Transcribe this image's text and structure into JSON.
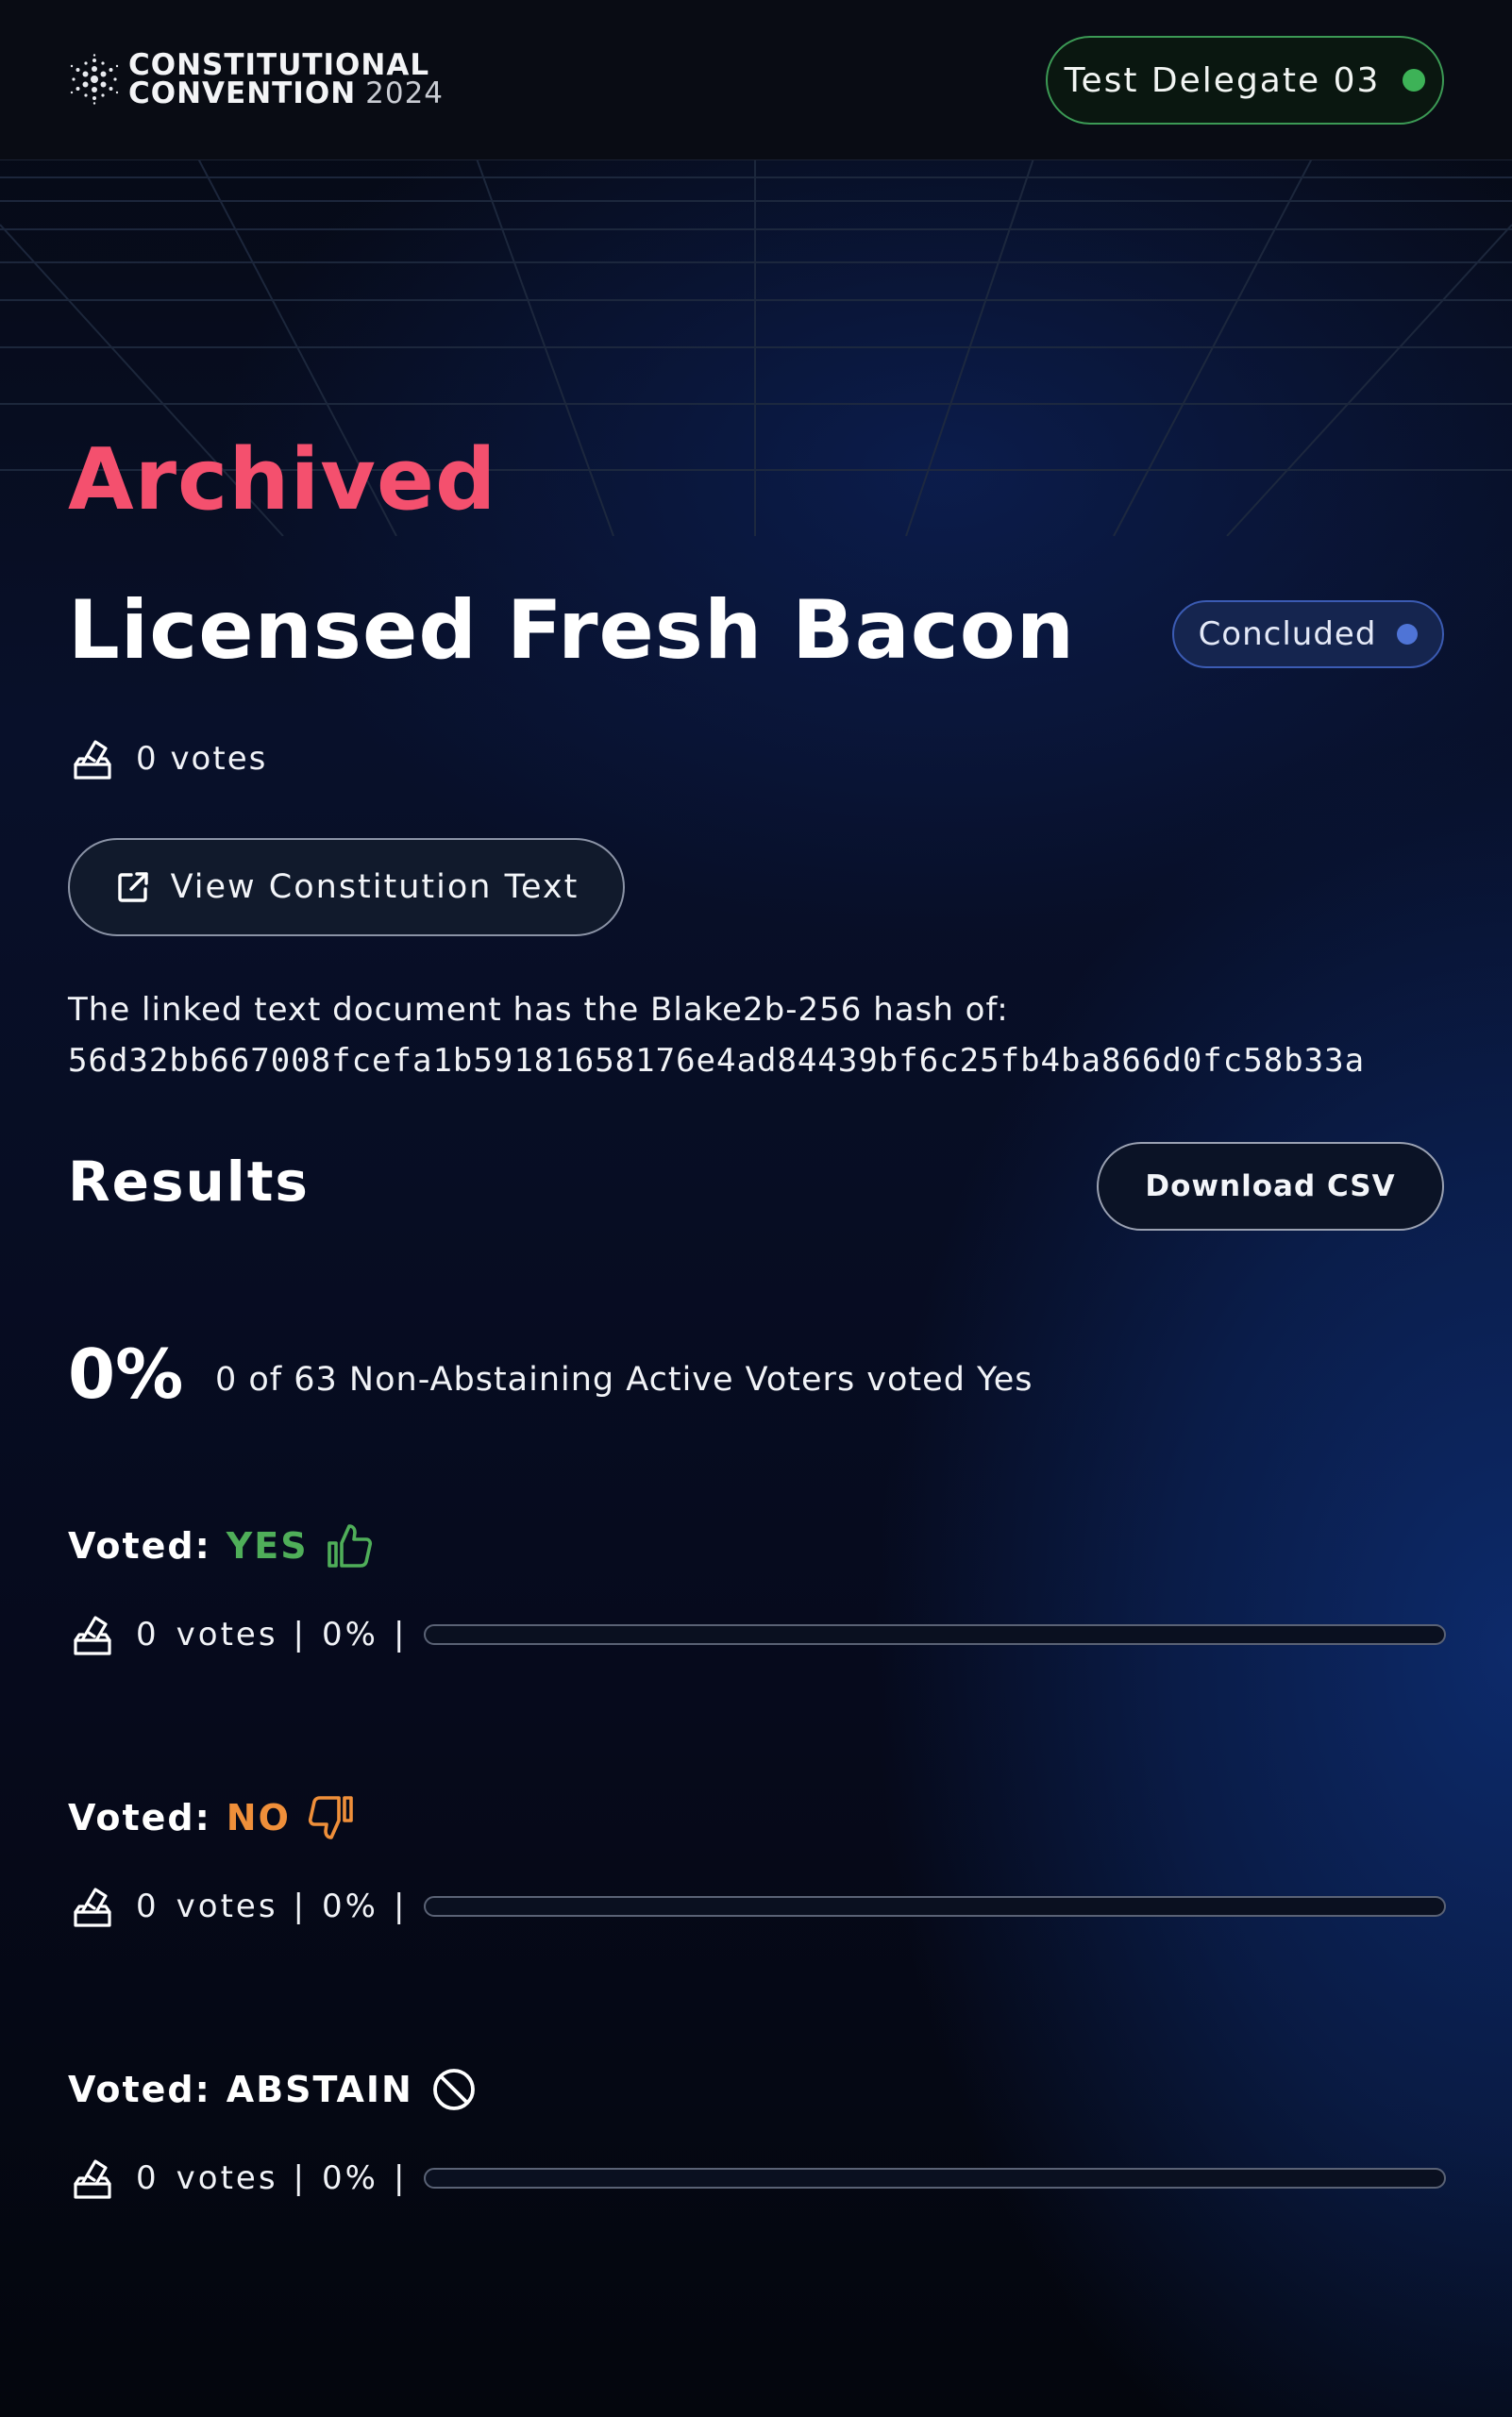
{
  "header": {
    "logo_line1": "CONSTITUTIONAL",
    "logo_line2": "CONVENTION",
    "logo_year": "2024",
    "logo_icon": "cardano-logo-icon",
    "delegate_name": "Test Delegate 03",
    "delegate_status_color": "#3db257"
  },
  "poll": {
    "archived_label": "Archived",
    "title": "Licensed Fresh Bacon",
    "status_label": "Concluded",
    "status_color": "#4f74d6",
    "vote_count_label": "0 votes",
    "view_button_label": "View Constitution Text",
    "hash_intro": "The linked text document has the Blake2b-256 hash of:",
    "hash_value": "56d32bb667008fcefa1b59181658176e4ad84439bf6c25fb4ba866d0fc58b33a"
  },
  "results": {
    "title": "Results",
    "download_label": "Download CSV",
    "percent": "0%",
    "summary": "0 of 63 Non-Abstaining Active Voters voted Yes",
    "options": [
      {
        "voted_label": "Voted:",
        "option": "YES",
        "icon": "thumbs-up-icon",
        "color": "#4fae59",
        "votes": "0",
        "votes_word": "votes",
        "percent": "0%",
        "fill": 0
      },
      {
        "voted_label": "Voted:",
        "option": "NO",
        "icon": "thumbs-down-icon",
        "color": "#ef8f3a",
        "votes": "0",
        "votes_word": "votes",
        "percent": "0%",
        "fill": 0
      },
      {
        "voted_label": "Voted:",
        "option": "ABSTAIN",
        "icon": "prohibited-icon",
        "color": "#ffffff",
        "votes": "0",
        "votes_word": "votes",
        "percent": "0%",
        "fill": 0
      }
    ]
  }
}
